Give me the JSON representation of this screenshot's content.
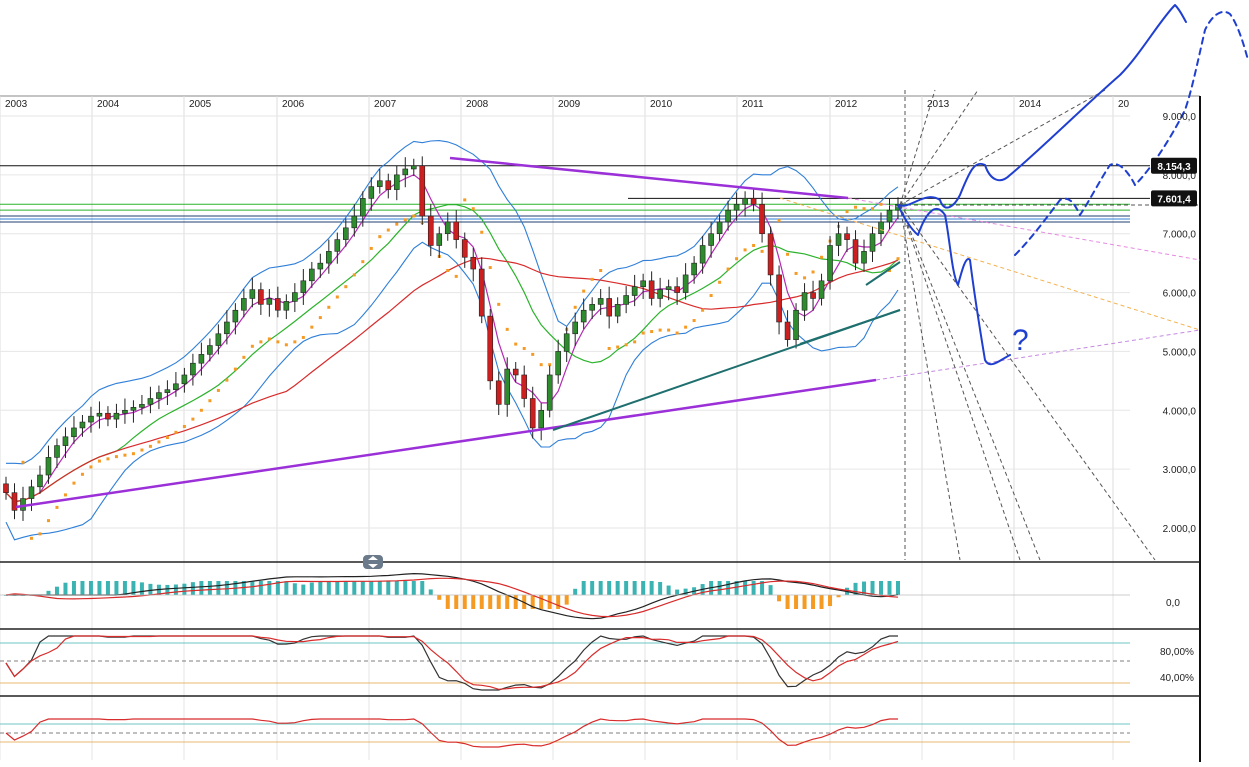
{
  "chart_data": [
    {
      "type": "candlestick",
      "panel": "price",
      "x_labels": [
        "2003",
        "2004",
        "2005",
        "2006",
        "2007",
        "2008",
        "2009",
        "2010",
        "2011",
        "2012",
        "2013",
        "2014",
        "20"
      ],
      "y_ticks": [
        "9.000,0",
        "8.000,0",
        "7.000,0",
        "6.000,0",
        "5.000,0",
        "4.000,0",
        "3.000,0",
        "2.000,0"
      ],
      "y_tick_values": [
        9000,
        8000,
        7000,
        6000,
        5000,
        4000,
        3000,
        2000
      ],
      "ylim": [
        1500,
        9300
      ],
      "price_tags": [
        {
          "label": "8.154,3",
          "value": 8154.3
        },
        {
          "label": "7.601,4",
          "value": 7601.4
        }
      ],
      "close_series": [
        2600,
        2300,
        2500,
        2700,
        2900,
        3200,
        3400,
        3550,
        3700,
        3800,
        3900,
        3950,
        3850,
        3950,
        4000,
        4050,
        4100,
        4200,
        4300,
        4350,
        4450,
        4600,
        4800,
        4950,
        5100,
        5300,
        5500,
        5700,
        5900,
        6050,
        5800,
        5900,
        5700,
        5850,
        6000,
        6200,
        6400,
        6500,
        6700,
        6900,
        7100,
        7300,
        7600,
        7800,
        7900,
        7750,
        8000,
        8100,
        8154,
        7300,
        6800,
        7000,
        7200,
        6900,
        6600,
        6400,
        5600,
        4500,
        4100,
        4700,
        4600,
        4200,
        3700,
        4000,
        4600,
        5000,
        5300,
        5500,
        5700,
        5800,
        5900,
        5600,
        5800,
        5950,
        6100,
        6200,
        5900,
        6050,
        6100,
        6000,
        6300,
        6500,
        6800,
        7000,
        7200,
        7400,
        7500,
        7601,
        7500,
        7000,
        6300,
        5500,
        5200,
        5700,
        6000,
        5900,
        6200,
        6800,
        7000,
        6900,
        6500,
        6700,
        7000,
        7200,
        7400,
        7500
      ],
      "colors": {
        "up": "#2e8b2e",
        "down": "#cc1f1f",
        "bollinger": "#2f7fd8",
        "sma_short": "#b32bb3",
        "sma_mid": "#2bb32b",
        "sma_long": "#d82b2b",
        "sar": "#f59a23",
        "trend_purple": "#9b30d8",
        "trend_teal": "#1f6f6f",
        "annotation": "#1f3fd0"
      },
      "annotation_text": "?"
    },
    {
      "type": "histogram",
      "panel": "macd",
      "y_ticks": [
        "0,0"
      ]
    },
    {
      "type": "line",
      "panel": "stochastic",
      "y_ticks": [
        "80,00%",
        "40,00%"
      ]
    },
    {
      "type": "line",
      "panel": "rsi",
      "y_ticks": []
    }
  ],
  "icons": {
    "scroll_handle": "collapse-handle-icon"
  }
}
